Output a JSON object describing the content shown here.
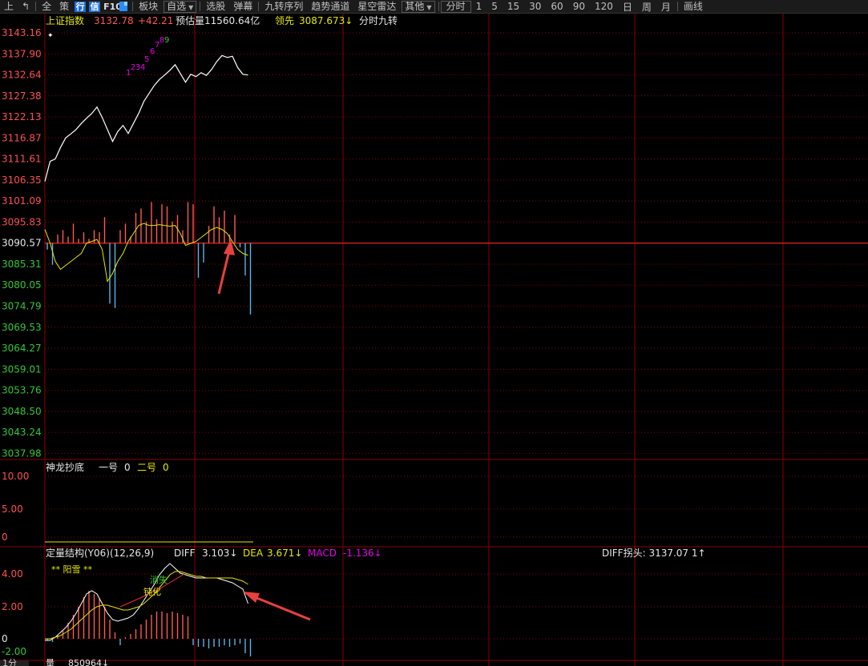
{
  "toolbar": {
    "icons": [
      "上",
      "↰"
    ],
    "items_left": [
      "全",
      "策"
    ],
    "active_icons": [
      "行",
      "信"
    ],
    "f10": "F10",
    "bookmark_icon": "bookmark-icon",
    "block": "板块",
    "zixuan": "自选",
    "items_mid": [
      "选股",
      "弹幕",
      "九转序列",
      "趋势通道",
      "星空雷达"
    ],
    "other": "其他",
    "timeframes": [
      "分时",
      "1",
      "5",
      "15",
      "30",
      "60",
      "90",
      "120",
      "日",
      "周",
      "月"
    ],
    "draw": "画线"
  },
  "main": {
    "index_name": "上证指数",
    "price": "3132.78",
    "change": "+42.21",
    "est_volume": "预估量11560.64亿",
    "lead_label": "领先",
    "lead_value": "3087.673↓",
    "nine_turn": "分时九转",
    "y_labels": [
      "3143.16",
      "3137.90",
      "3132.64",
      "3127.38",
      "3122.13",
      "3116.87",
      "3111.61",
      "3106.35",
      "3101.09",
      "3095.83",
      "3090.57",
      "3085.31",
      "3080.05",
      "3074.79",
      "3069.53",
      "3064.27",
      "3059.01",
      "3053.76",
      "3048.50",
      "3043.24",
      "3037.98"
    ],
    "nine_marks": [
      "1",
      "2",
      "3",
      "4",
      "5",
      "6",
      "7",
      "8",
      "9"
    ]
  },
  "panel2": {
    "title": "神龙抄底",
    "label1": "一号",
    "val1": "0",
    "label2": "二号",
    "val2": "0",
    "y_labels": [
      "10.00",
      "5.00",
      "0"
    ]
  },
  "panel3": {
    "title": "定量结构(Y06)(12,26,9)",
    "diff_label": "DIFF",
    "diff_val": "3.103↓",
    "dea_label": "DEA",
    "dea_val": "3.671↓",
    "macd_label": "MACD",
    "macd_val": "-1.136↓",
    "diff_turn": "DIFF拐头: 3137.07 1↑",
    "yang_snow": "** 阳雪 **",
    "vanish": "消失",
    "passivate": "钝化",
    "y_labels": [
      "4.00",
      "2.00",
      "0",
      "-2.00"
    ]
  },
  "bottom": {
    "tab": "1分",
    "volume_label": "量",
    "volume_val": "850964↓"
  },
  "colors": {
    "grid": "#8b0000",
    "baseline": "#c81e1e",
    "up": "#ff5a50",
    "down": "#5ab4e6",
    "yellow": "#e6e600",
    "magenta": "#e600e6",
    "green": "#32c832",
    "ylabel_red": "#ff5050",
    "ylabel_green": "#32c832",
    "price_line": "#ffffff"
  }
}
